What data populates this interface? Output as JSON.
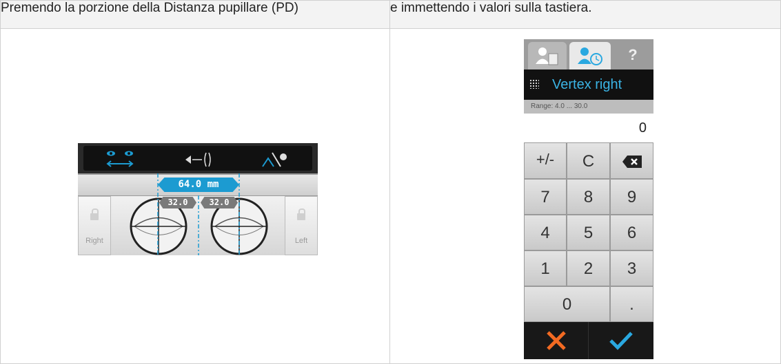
{
  "table": {
    "left_header": "Premendo la porzione della Distanza pupillare (PD)",
    "right_header": "e immettendo i valori sulla tastiera."
  },
  "pd_widget": {
    "total": "64.0 mm",
    "right_half": "32.0",
    "left_half": "32.0",
    "right_label": "Right",
    "left_label": "Left",
    "icons": [
      "eyes-distance-icon",
      "vertex-distance-icon",
      "near-far-icon",
      "lock-icon"
    ]
  },
  "keypad": {
    "tabs": [
      "patient-info-icon",
      "history-icon",
      "?"
    ],
    "title": "Vertex right",
    "range": "Range: 4.0 ... 30.0",
    "value": "0",
    "keys": {
      "sign": "+/-",
      "clear": "C",
      "k7": "7",
      "k8": "8",
      "k9": "9",
      "k4": "4",
      "k5": "5",
      "k6": "6",
      "k1": "1",
      "k2": "2",
      "k3": "3",
      "k0": "0",
      "dot": "."
    },
    "colors": {
      "accent": "#3bb4e5",
      "cancel": "#f26a22",
      "confirm": "#2aa8e0"
    }
  }
}
